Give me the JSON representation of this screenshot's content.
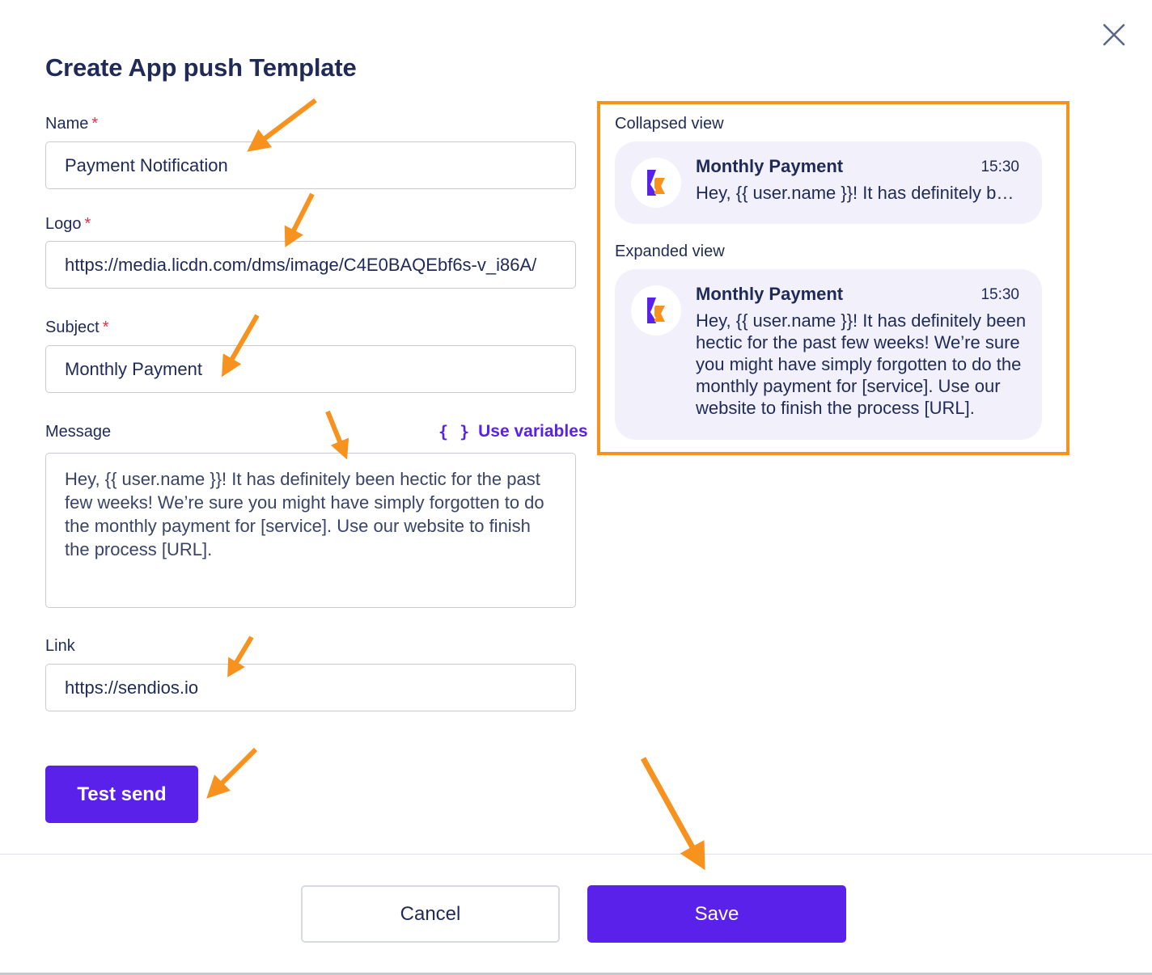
{
  "dialog": {
    "title": "Create App push Template",
    "close_icon": "close-icon"
  },
  "form": {
    "name": {
      "label": "Name",
      "required_mark": "*",
      "value": "Payment Notification"
    },
    "logo": {
      "label": "Logo",
      "required_mark": "*",
      "value": "https://media.licdn.com/dms/image/C4E0BAQEbf6s-v_i86A/"
    },
    "subject": {
      "label": "Subject",
      "required_mark": "*",
      "value": "Monthly Payment"
    },
    "message": {
      "label": "Message",
      "value": "Hey, {{ user.name }}! It has definitely been hectic for the past few weeks! We’re sure you might have simply forgotten to do the monthly payment for [service]. Use our website to finish the process [URL].",
      "use_variables_icon": "{ }",
      "use_variables_label": "Use variables"
    },
    "link": {
      "label": "Link",
      "value": "https://sendios.io"
    },
    "test_send_label": "Test send"
  },
  "preview": {
    "collapsed": {
      "label": "Collapsed view",
      "title": "Monthly Payment",
      "time": "15:30",
      "body": "Hey, {{ user.name }}! It has definitely been hectic for the past few weeks! We’re sure you might have simply forgotten to do the monthly payment for [service]. Use our website to finish the process [URL]."
    },
    "expanded": {
      "label": "Expanded view",
      "title": "Monthly Payment",
      "time": "15:30",
      "body": "Hey, {{ user.name }}! It has definitely been hectic for the past few weeks! We’re sure you might have simply forgotten to do the monthly payment for [service]. Use our website to finish the process [URL]."
    }
  },
  "footer": {
    "cancel_label": "Cancel",
    "save_label": "Save"
  },
  "colors": {
    "accent": "#5a21ea",
    "annotation": "#f7921e",
    "text": "#1f2a56",
    "required": "#e0314b"
  }
}
